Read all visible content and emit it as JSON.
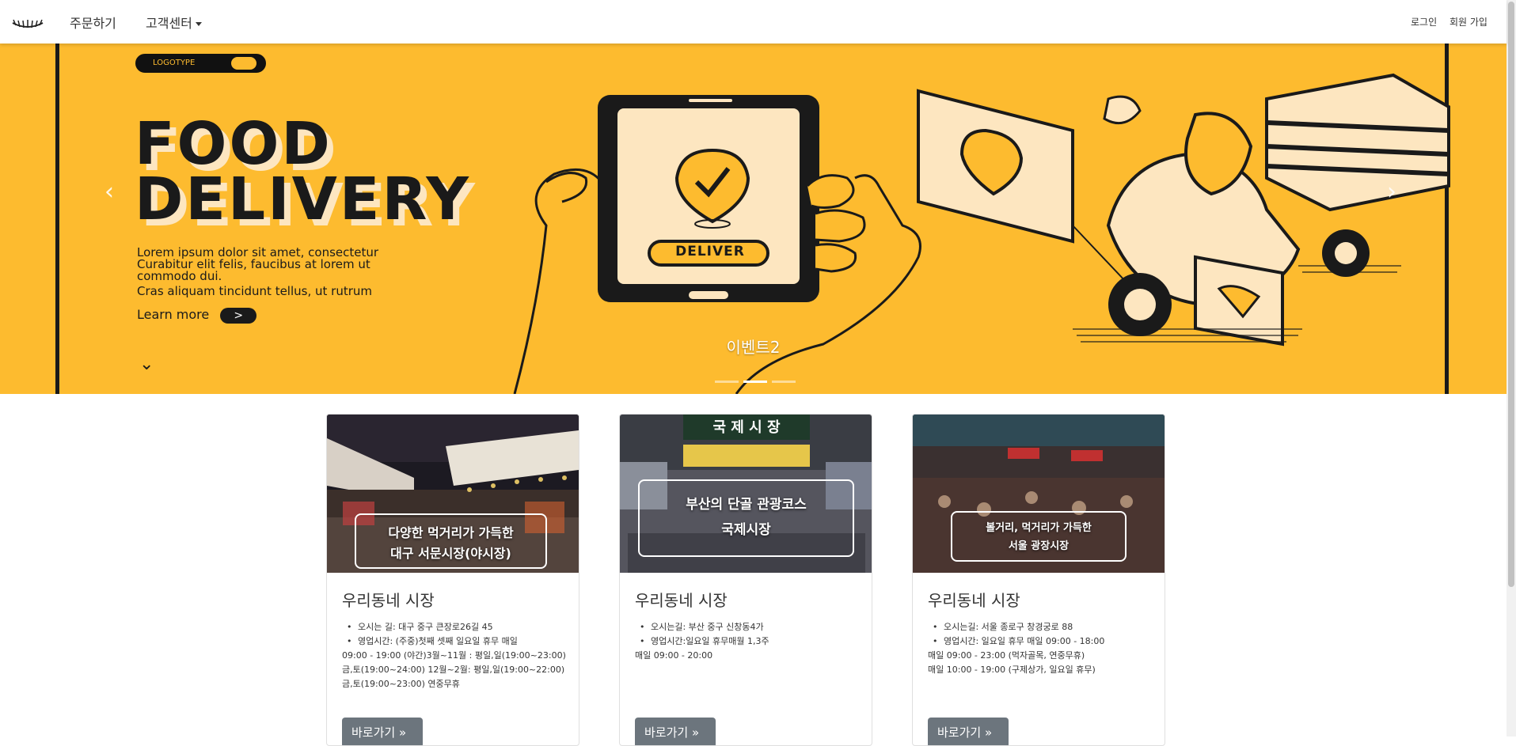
{
  "nav": {
    "brand_icon": "eyelash-logo-icon",
    "order": "주문하기",
    "support": "고객센터",
    "login": "로그인",
    "signup": "회원 가입"
  },
  "hero": {
    "logo_text": "LOGOTYPE",
    "title_line1": "FOOD",
    "title_line2": "DELIVERY",
    "desc_line1": "Lorem ipsum dolor sit amet, consectetur",
    "desc_line2": "Curabitur elit felis, faucibus at lorem ut",
    "desc_line3": "commodo dui.",
    "desc_line4": "Cras aliquam tincidunt tellus, ut rutrum",
    "learn_more": "Learn more",
    "learn_arrow": ">",
    "phone_button": "DELIVER",
    "caption": "이벤트2",
    "prev": "‹",
    "next": "›",
    "down": "⌄",
    "indicator_count": 3,
    "active_indicator": 2,
    "bg_color": "#fdbb2f"
  },
  "cards": [
    {
      "overlay_line1": "다양한 먹거리가 가득한",
      "overlay_line2": "대구 서문시장(야시장)",
      "title": "우리동네 시장",
      "items": [
        "오시는 길: 대구 중구 큰장로26길 45",
        "영업시간: (주중)첫째 셋째 일요일 휴무 매일"
      ],
      "extra": [
        "09:00 - 19:00 (야간)3월~11월 : 평일,일(19:00~23:00)",
        "금,토(19:00~24:00) 12월~2월: 평일,일(19:00~22:00)",
        "금,토(19:00~23:00) 연중무휴"
      ],
      "button": "바로가기 »"
    },
    {
      "overlay_line1": "부산의 단골 관광코스",
      "overlay_line2": "국제시장",
      "title": "우리동네 시장",
      "items": [
        "오시는길: 부산 중구 신창동4가",
        "영업시간:일요일 휴무매월 1,3주"
      ],
      "extra": [
        "매일 09:00 - 20:00"
      ],
      "button": "바로가기 »"
    },
    {
      "overlay_line1": "볼거리, 먹거리가 가득한",
      "overlay_line2": "서울 광장시장",
      "title": "우리동네 시장",
      "items": [
        "오시는길: 서울 종로구 창경궁로 88",
        "영업시간: 일요일 휴무 매일 09:00 - 18:00"
      ],
      "extra": [
        "매일 09:00 - 23:00 (먹자골목, 연중무휴)",
        "매일 10:00 - 19:00 (구제상가, 일요일 휴무)"
      ],
      "button": "바로가기 »"
    }
  ]
}
